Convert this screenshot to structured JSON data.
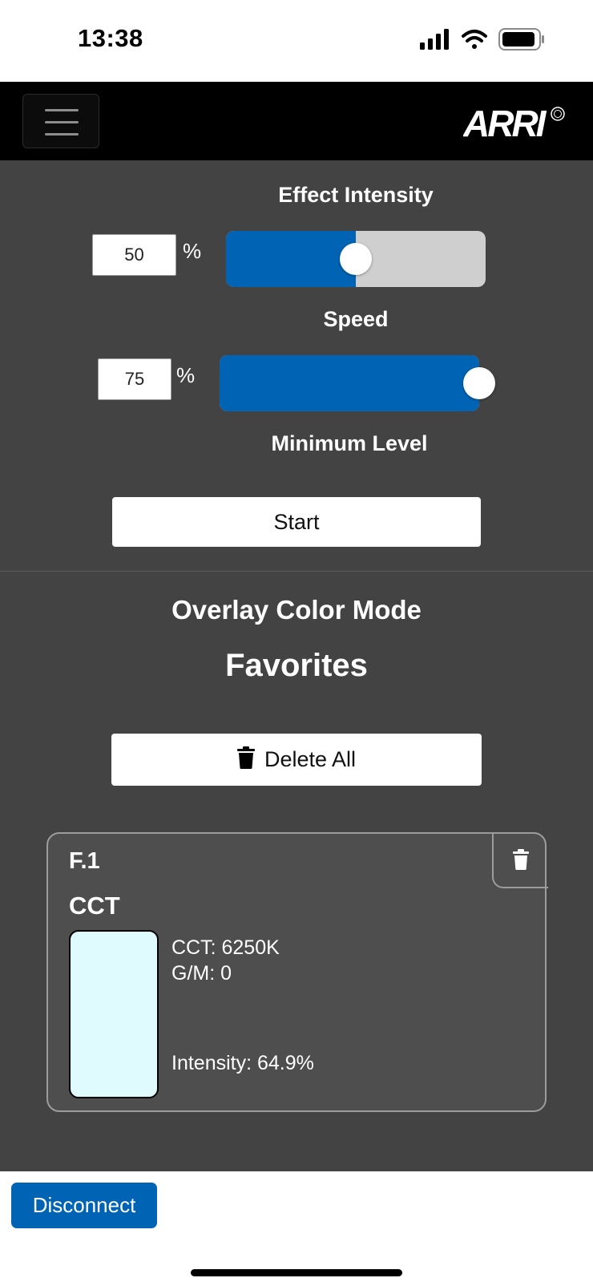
{
  "status_bar": {
    "time": "13:38",
    "icons": [
      "signal-icon",
      "wifi-icon",
      "battery-icon"
    ]
  },
  "navbar": {
    "menu_icon": "hamburger-menu-icon",
    "logo_text": "ARRI"
  },
  "effect_intensity": {
    "label": "Effect Intensity",
    "value": "50",
    "unit": "%",
    "slider_fraction": 0.5
  },
  "speed": {
    "label": "Speed",
    "value": "75",
    "unit": "%",
    "slider_fraction": 1.0
  },
  "minimum_level": {
    "label": "Minimum Level"
  },
  "start_button": "Start",
  "overlay_title": "Overlay Color Mode",
  "favorites": {
    "title": "Favorites",
    "delete_all_label": "Delete All",
    "items": [
      {
        "id": "F.1",
        "type": "CCT",
        "cct": "CCT: 6250K",
        "gm": "G/M: 0",
        "intensity": "Intensity: 64.9%",
        "swatch_color": "#e0fbfd"
      }
    ]
  },
  "disconnect_label": "Disconnect",
  "colors": {
    "accent": "#0063b3",
    "background": "#434343",
    "navbar": "#000000"
  }
}
